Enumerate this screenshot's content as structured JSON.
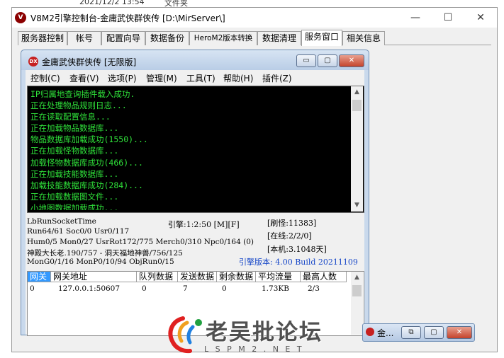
{
  "top_strip": {
    "date": "2021/12/2 13:54",
    "type": "文件夹"
  },
  "outer_window": {
    "title": "V8M2引擎控制台-金庸武侠群侠传 [D:\\MirServer\\]",
    "logo_text": "V",
    "minimize_glyph": "—",
    "maximize_glyph": "☐",
    "close_glyph": "✕"
  },
  "tabs": [
    {
      "label": "服务器控制"
    },
    {
      "label": "帐号"
    },
    {
      "label": "配置向导"
    },
    {
      "label": "数据备份"
    },
    {
      "label": "HeroM2版本转换"
    },
    {
      "label": "数据清理"
    },
    {
      "label": "服务窗口",
      "active": true
    },
    {
      "label": "相关信息"
    }
  ],
  "inner_window": {
    "icon_text": "DX",
    "title": "金庸武侠群侠传 [无限版]",
    "minimize_glyph": "▭",
    "maximize_glyph": "▢",
    "close_glyph": "✕"
  },
  "menu": [
    {
      "label": "控制(C)"
    },
    {
      "label": "查看(V)"
    },
    {
      "label": "选项(P)"
    },
    {
      "label": "管理(M)"
    },
    {
      "label": "工具(T)"
    },
    {
      "label": "帮助(H)"
    },
    {
      "label": "插件(Z)"
    }
  ],
  "console": {
    "text_color": "#2fe23a",
    "lines": [
      "IP归属地查询插件载入成功.",
      "正在处理物品规则日志...",
      "正在读取配置信息...",
      "正在加载物品数据库...",
      "物品数据库加载成功(1550)...",
      "正在加载怪物数据库...",
      "加载怪物数据库成功(466)...",
      "正在加载技能数据库...",
      "加载技能数据库成功(284)...",
      "正在加载数据图文件...",
      "小地图数据加载成功..."
    ],
    "scroll_up": "▲",
    "scroll_down": "▼"
  },
  "status": {
    "socket_time": "LbRunSocketTime",
    "engine": "引擎:1:2:50 [M][F]",
    "refresh_monsters": "[刷怪:11383]",
    "run_line": "Run64/61 Soc0/0 Usr0/117",
    "online": "[在线:2/2/0]",
    "hum_line": "Hum0/5 Mon0/27 UsrRot172/775 Merch0/310 Npc0/164 (0)",
    "local_days": "[本机:3.1048天]",
    "map_line": "神殿大长老.190/757 - 洞天福地神兽/756/125",
    "mon_line": "MonG0/1/16 MonP0/10/94 ObjRun0/15",
    "engine_version": "引擎版本: 4.00 Build 20211109"
  },
  "gateway_grid": {
    "columns": [
      "网关",
      "网关地址",
      "队列数据",
      "发送数据",
      "剩余数据",
      "平均流量",
      "最高人数"
    ],
    "rows": [
      [
        "0",
        "127.0.0.1:50607",
        "0",
        "7",
        "0",
        "1.73KB",
        "2/3"
      ]
    ]
  },
  "taskbar": {
    "mini_title": "金...",
    "restore_glyph": "⧉",
    "maximize_glyph": "▢",
    "close_glyph": "✕"
  },
  "watermark": {
    "title": "老吴批论坛",
    "domain": "L S P M 2 . N E T"
  }
}
